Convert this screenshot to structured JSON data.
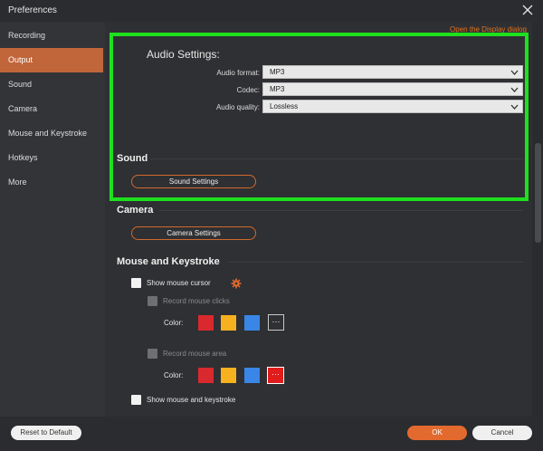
{
  "window": {
    "title": "Preferences"
  },
  "sidebar": {
    "items": [
      {
        "label": "Recording"
      },
      {
        "label": "Output"
      },
      {
        "label": "Sound"
      },
      {
        "label": "Camera"
      },
      {
        "label": "Mouse and Keystroke"
      },
      {
        "label": "Hotkeys"
      },
      {
        "label": "More"
      }
    ],
    "active_index": 1
  },
  "top_link": "Open the Display dialog",
  "audio": {
    "title": "Audio Settings:",
    "rows": [
      {
        "label": "Audio format:",
        "value": "MP3"
      },
      {
        "label": "Codec:",
        "value": "MP3"
      },
      {
        "label": "Audio quality:",
        "value": "Lossless"
      }
    ]
  },
  "sound": {
    "title": "Sound",
    "button": "Sound Settings"
  },
  "camera": {
    "title": "Camera",
    "button": "Camera Settings"
  },
  "mouse": {
    "title": "Mouse and Keystroke",
    "show_cursor": "Show mouse cursor",
    "record_clicks": "Record mouse clicks",
    "color_label": "Color:",
    "record_area": "Record mouse area",
    "show_keystroke": "Show mouse and keystroke",
    "more_glyph": "···",
    "swatch_colors": [
      "#d8292e",
      "#f7b11e",
      "#3a86e6"
    ],
    "selected_more_color": "#e01c1c"
  },
  "footer": {
    "reset": "Reset to Default",
    "ok": "OK",
    "cancel": "Cancel"
  },
  "colors": {
    "accent": "#d2692e",
    "highlight": "#1ee01e"
  }
}
